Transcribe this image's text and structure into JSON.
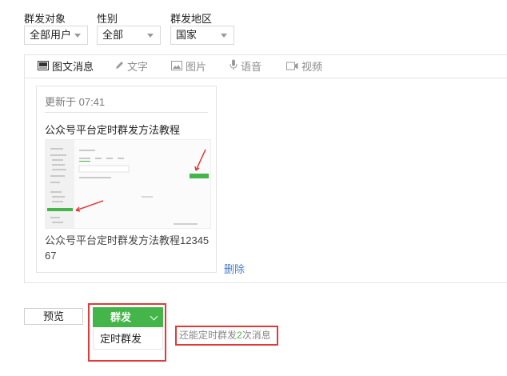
{
  "filters": {
    "target": {
      "label": "群发对象",
      "value": "全部用户"
    },
    "gender": {
      "label": "性别",
      "value": "全部"
    },
    "region": {
      "label": "群发地区",
      "value": "国家"
    }
  },
  "tabs": [
    {
      "label": "图文消息",
      "icon": "image-text-icon",
      "active": true
    },
    {
      "label": "文字",
      "icon": "pencil-icon",
      "active": false
    },
    {
      "label": "图片",
      "icon": "picture-icon",
      "active": false
    },
    {
      "label": "语音",
      "icon": "microphone-icon",
      "active": false
    },
    {
      "label": "视频",
      "icon": "video-camera-icon",
      "active": false
    }
  ],
  "article": {
    "updated": "更新于 07:41",
    "title": "公众号平台定时群发方法教程",
    "description": "公众号平台定时群发方法教程1234567",
    "delete_label": "删除"
  },
  "actions": {
    "preview_label": "预览",
    "send_label": "群发",
    "scheduled_label": "定时群发"
  },
  "quota": {
    "prefix": "还能定时群发",
    "count": "2",
    "suffix": "次消息"
  },
  "colors": {
    "accent": "#44b549",
    "highlight": "#e23a3a",
    "link": "#4a7dc4"
  }
}
